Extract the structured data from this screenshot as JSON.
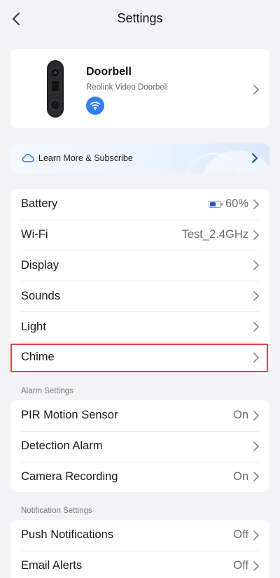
{
  "header": {
    "title": "Settings"
  },
  "device": {
    "name": "Doorbell",
    "model": "Reolink Video Doorbell"
  },
  "banner": {
    "text": "Learn More & Subscribe"
  },
  "group_main": [
    {
      "key": "battery",
      "label": "Battery",
      "value": "60%",
      "battery_level": 0.6
    },
    {
      "key": "wifi",
      "label": "Wi-Fi",
      "value": "Test_2.4GHz"
    },
    {
      "key": "display",
      "label": "Display",
      "value": ""
    },
    {
      "key": "sounds",
      "label": "Sounds",
      "value": ""
    },
    {
      "key": "light",
      "label": "Light",
      "value": ""
    },
    {
      "key": "chime",
      "label": "Chime",
      "value": ""
    }
  ],
  "alarm_section": {
    "title": "Alarm Settings",
    "rows": [
      {
        "label": "PIR Motion Sensor",
        "value": "On"
      },
      {
        "label": "Detection Alarm",
        "value": ""
      },
      {
        "label": "Camera Recording",
        "value": "On"
      }
    ]
  },
  "notification_section": {
    "title": "Notification Settings",
    "rows": [
      {
        "label": "Push Notifications",
        "value": "Off"
      },
      {
        "label": "Email Alerts",
        "value": "Off"
      }
    ]
  },
  "colors": {
    "accent": "#2f7ff5",
    "highlight": "#e0453a",
    "battery_fill": "#1f55d6"
  }
}
